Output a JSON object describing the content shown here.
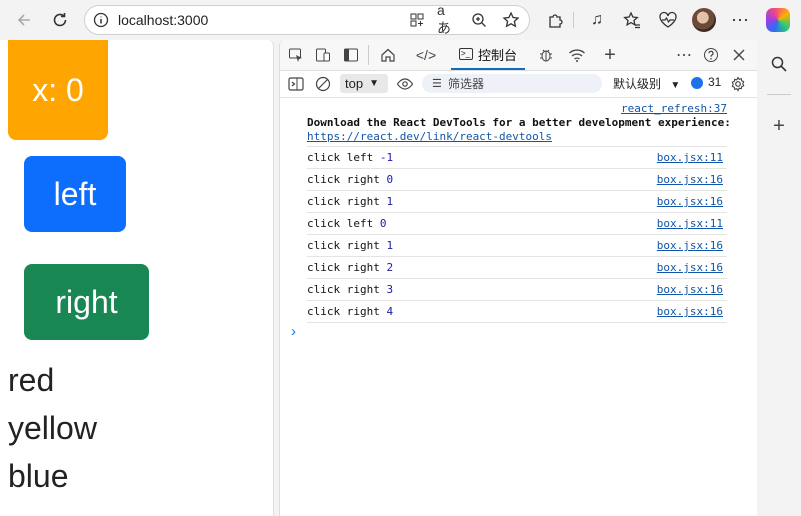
{
  "browser": {
    "url": "localhost:3000",
    "icons": [
      "back-icon",
      "reload-icon",
      "info-icon",
      "grid-icon",
      "read-aloud-icon",
      "zoom-icon",
      "favorite-icon",
      "extensions-icon",
      "media-icon",
      "favorites-icon",
      "health-icon",
      "more-icon"
    ]
  },
  "page": {
    "x_label": "x: 0",
    "left_label": "left",
    "right_label": "right",
    "colors": [
      "red",
      "yellow",
      "blue"
    ],
    "accent": {
      "x_box": "#ffa500",
      "left": "#0d6efd",
      "right": "#198754"
    }
  },
  "devtools": {
    "console_tab": "控制台",
    "context": "top",
    "filter_placeholder": "筛选器",
    "level": "默认级别",
    "message_count": "31",
    "intro_source": "react_refresh:37",
    "intro_message": "Download the React DevTools for a better development experience:",
    "intro_link": "https://react.dev/link/react-devtools",
    "logs": [
      {
        "text": "click left",
        "num": "-1",
        "src": "box.jsx:11"
      },
      {
        "text": "click right",
        "num": "0",
        "src": "box.jsx:16"
      },
      {
        "text": "click right",
        "num": "1",
        "src": "box.jsx:16"
      },
      {
        "text": "click left",
        "num": "0",
        "src": "box.jsx:11"
      },
      {
        "text": "click right",
        "num": "1",
        "src": "box.jsx:16"
      },
      {
        "text": "click right",
        "num": "2",
        "src": "box.jsx:16"
      },
      {
        "text": "click right",
        "num": "3",
        "src": "box.jsx:16"
      },
      {
        "text": "click right",
        "num": "4",
        "src": "box.jsx:16"
      }
    ],
    "prompt": "›"
  }
}
